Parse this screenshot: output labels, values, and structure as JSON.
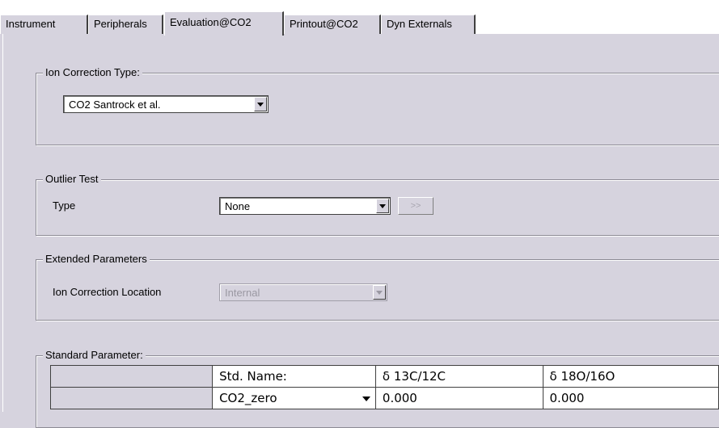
{
  "tabs": [
    {
      "label": "Instrument",
      "active": false
    },
    {
      "label": "Peripherals",
      "active": false
    },
    {
      "label": "Evaluation@CO2",
      "active": true
    },
    {
      "label": "Printout@CO2",
      "active": false
    },
    {
      "label": "Dyn Externals",
      "active": false
    }
  ],
  "ion_correction": {
    "legend": "Ion Correction Type:",
    "value": "CO2 Santrock et al."
  },
  "outlier": {
    "legend": "Outlier Test",
    "type_label": "Type",
    "type_value": "None",
    "more_button": ">>"
  },
  "extended": {
    "legend": "Extended Parameters",
    "location_label": "Ion Correction Location",
    "location_value": "Internal"
  },
  "standard": {
    "legend": "Standard Parameter:",
    "columns": [
      "",
      "Std. Name:",
      "δ 13C/12C",
      "δ 18O/16O"
    ],
    "rows": [
      {
        "name": "CO2_zero",
        "d13c": "0.000",
        "d18o": "0.000"
      }
    ]
  },
  "colors": {
    "face": "#d6d3de",
    "disabled_text": "#9a98a2"
  }
}
